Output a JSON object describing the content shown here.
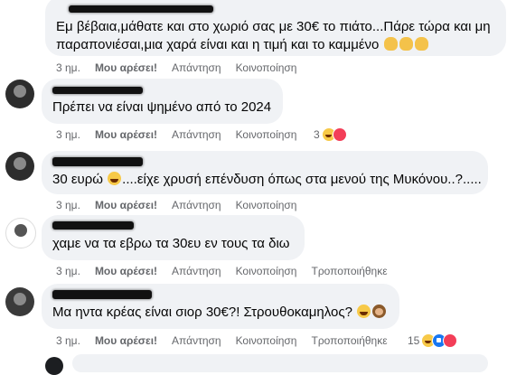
{
  "comments": [
    {
      "text_line1": "Εμ βέβαια,μάθατε και στο χωριό σας με 30€ το πιάτο...Πάρε τώρα και μη",
      "text_line2": "παραπονιέσαι,μια χαρά είναι και η τιμή και το καμμένο",
      "emojis": [
        "clapping-hands",
        "clapping-hands",
        "clapping-hands"
      ],
      "time": "3 ημ.",
      "like": "Μου αρέσει!",
      "reply": "Απάντηση",
      "share": "Κοινοποίηση"
    },
    {
      "text": "Πρέπει να είναι ψημένο από το 2024",
      "time": "3 ημ.",
      "like": "Μου αρέσει!",
      "reply": "Απάντηση",
      "share": "Κοινοποίηση",
      "reaction_count": "3",
      "reactions": [
        "haha",
        "love"
      ]
    },
    {
      "text_before": "30 ευρώ",
      "text_after": "....είχε χρυσή επένδυση όπως στα μενού της Μυκόνου..?.....",
      "emoji": "grinning-sweat",
      "time": "3 ημ.",
      "like": "Μου αρέσει!",
      "reply": "Απάντηση",
      "share": "Κοινοποίηση"
    },
    {
      "text": "χαμε να τα εβρω τα 30ευ εν τους τα διω",
      "time": "3 ημ.",
      "like": "Μου αρέσει!",
      "reply": "Απάντηση",
      "share": "Κοινοποίηση",
      "edited": "Τροποποιήθηκε"
    },
    {
      "text": "Μα ηντα κρέας είναι σιορ 30€?! Στρουθοκαμηλος?",
      "emojis": [
        "rolling-laughing",
        "see-no-evil-monkey"
      ],
      "time": "3 ημ.",
      "like": "Μου αρέσει!",
      "reply": "Απάντηση",
      "share": "Κοινοποίηση",
      "edited": "Τροποποιήθηκε",
      "reaction_count": "15",
      "reactions": [
        "haha",
        "like",
        "love"
      ]
    }
  ]
}
